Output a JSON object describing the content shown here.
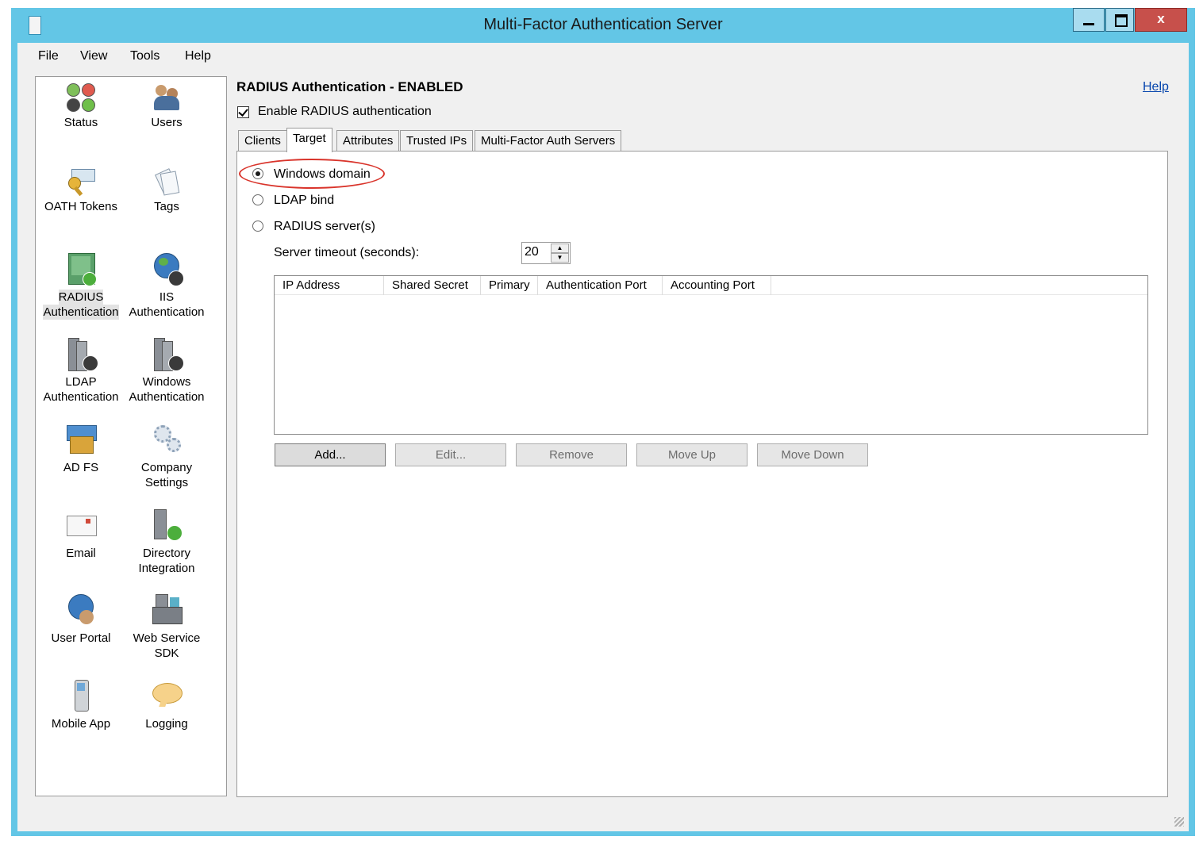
{
  "window": {
    "title": "Multi-Factor Authentication Server",
    "colors": {
      "frame": "#63c6e6",
      "close_button": "#c7504b",
      "highlight": "#d9342b"
    }
  },
  "menu": [
    "File",
    "View",
    "Tools",
    "Help"
  ],
  "sidebar": {
    "items": [
      {
        "label1": "Status",
        "label2": "",
        "icon": "status-icon"
      },
      {
        "label1": "Users",
        "label2": "",
        "icon": "users-icon"
      },
      {
        "label1": "OATH Tokens",
        "label2": "",
        "icon": "key-icon"
      },
      {
        "label1": "Tags",
        "label2": "",
        "icon": "tags-icon"
      },
      {
        "label1": "RADIUS",
        "label2": "Authentication",
        "icon": "radius-icon",
        "selected": true
      },
      {
        "label1": "IIS",
        "label2": "Authentication",
        "icon": "globe-icon"
      },
      {
        "label1": "LDAP",
        "label2": "Authentication",
        "icon": "server-icon"
      },
      {
        "label1": "Windows",
        "label2": "Authentication",
        "icon": "server-icon"
      },
      {
        "label1": "AD FS",
        "label2": "",
        "icon": "adfs-icon"
      },
      {
        "label1": "Company",
        "label2": "Settings",
        "icon": "gears-icon"
      },
      {
        "label1": "Email",
        "label2": "",
        "icon": "envelope-icon"
      },
      {
        "label1": "Directory",
        "label2": "Integration",
        "icon": "directory-icon"
      },
      {
        "label1": "User Portal",
        "label2": "",
        "icon": "portal-icon"
      },
      {
        "label1": "Web Service",
        "label2": "SDK",
        "icon": "sdk-icon"
      },
      {
        "label1": "Mobile App",
        "label2": "",
        "icon": "phone-icon"
      },
      {
        "label1": "Logging",
        "label2": "",
        "icon": "speech-bubble-icon"
      }
    ]
  },
  "main": {
    "heading": "RADIUS Authentication - ENABLED",
    "help_link": "Help",
    "enable_checkbox": {
      "label": "Enable RADIUS authentication",
      "checked": true
    },
    "tabs": [
      "Clients",
      "Target",
      "Attributes",
      "Trusted IPs",
      "Multi-Factor Auth Servers"
    ],
    "active_tab": "Target",
    "target": {
      "options": [
        {
          "label": "Windows domain",
          "selected": true
        },
        {
          "label": "LDAP bind",
          "selected": false
        },
        {
          "label": "RADIUS server(s)",
          "selected": false
        }
      ],
      "timeout_label": "Server timeout (seconds):",
      "timeout_value": "20",
      "table_columns": [
        "IP Address",
        "Shared Secret",
        "Primary",
        "Authentication Port",
        "Accounting Port"
      ],
      "table_rows": [],
      "buttons": [
        "Add...",
        "Edit...",
        "Remove",
        "Move Up",
        "Move Down"
      ]
    }
  }
}
